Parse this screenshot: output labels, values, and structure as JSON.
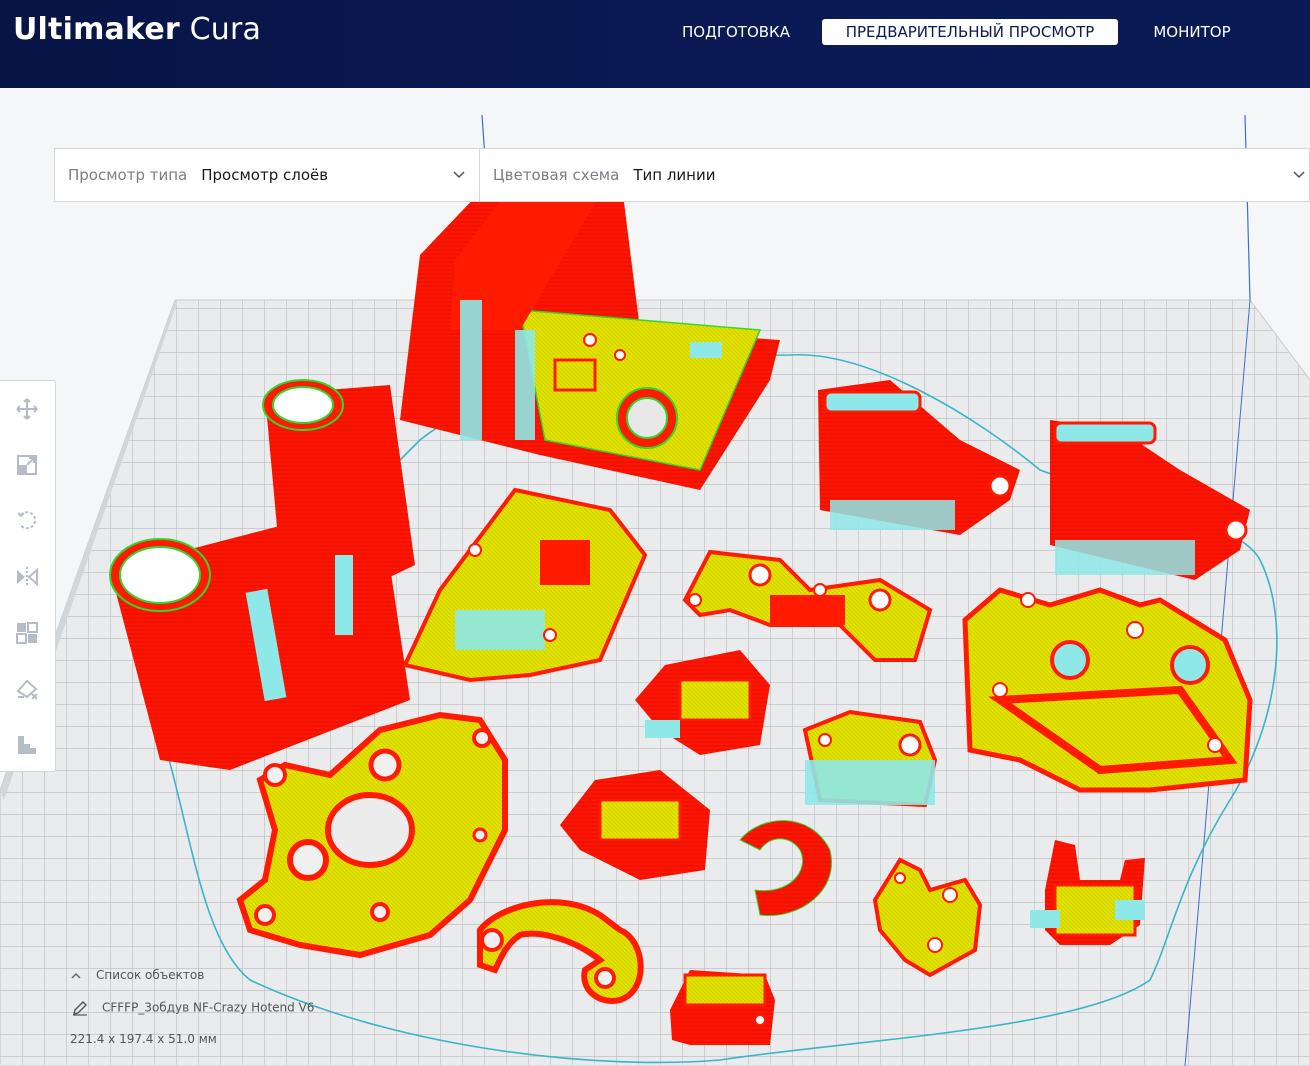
{
  "app": {
    "brand_bold": "Ultimaker",
    "brand_light": " Cura"
  },
  "stages": [
    {
      "label": "ПОДГОТОВКА",
      "active": false
    },
    {
      "label": "ПРЕДВАРИТЕЛЬНЫЙ ПРОСМОТР",
      "active": true
    },
    {
      "label": "МОНИТОР",
      "active": false
    }
  ],
  "view_selector": {
    "label": "Просмотр типа",
    "value": "Просмотр слоёв"
  },
  "color_selector": {
    "label": "Цветовая схема",
    "value": "Тип линии"
  },
  "toolbar": [
    {
      "name": "move-tool-icon"
    },
    {
      "name": "scale-tool-icon"
    },
    {
      "name": "rotate-tool-icon"
    },
    {
      "name": "mirror-tool-icon"
    },
    {
      "name": "per-model-settings-icon"
    },
    {
      "name": "support-blocker-icon"
    },
    {
      "name": "layer-icon"
    }
  ],
  "object_list": {
    "header": "Список объектов",
    "job_name": "CFFFP_3обдув NF-Crazy Hotend V6",
    "dimensions": "221.4 x 197.4 x 51.0 мм"
  },
  "colors": {
    "header_bg": "#0b1a55",
    "wall": "#ff1a00",
    "infill": "#e6e600",
    "inner_wall": "#2fd82f",
    "support": "#8ee8e8",
    "grid_line": "#b9bcbf",
    "grid_bg": "#e4e6e8"
  }
}
